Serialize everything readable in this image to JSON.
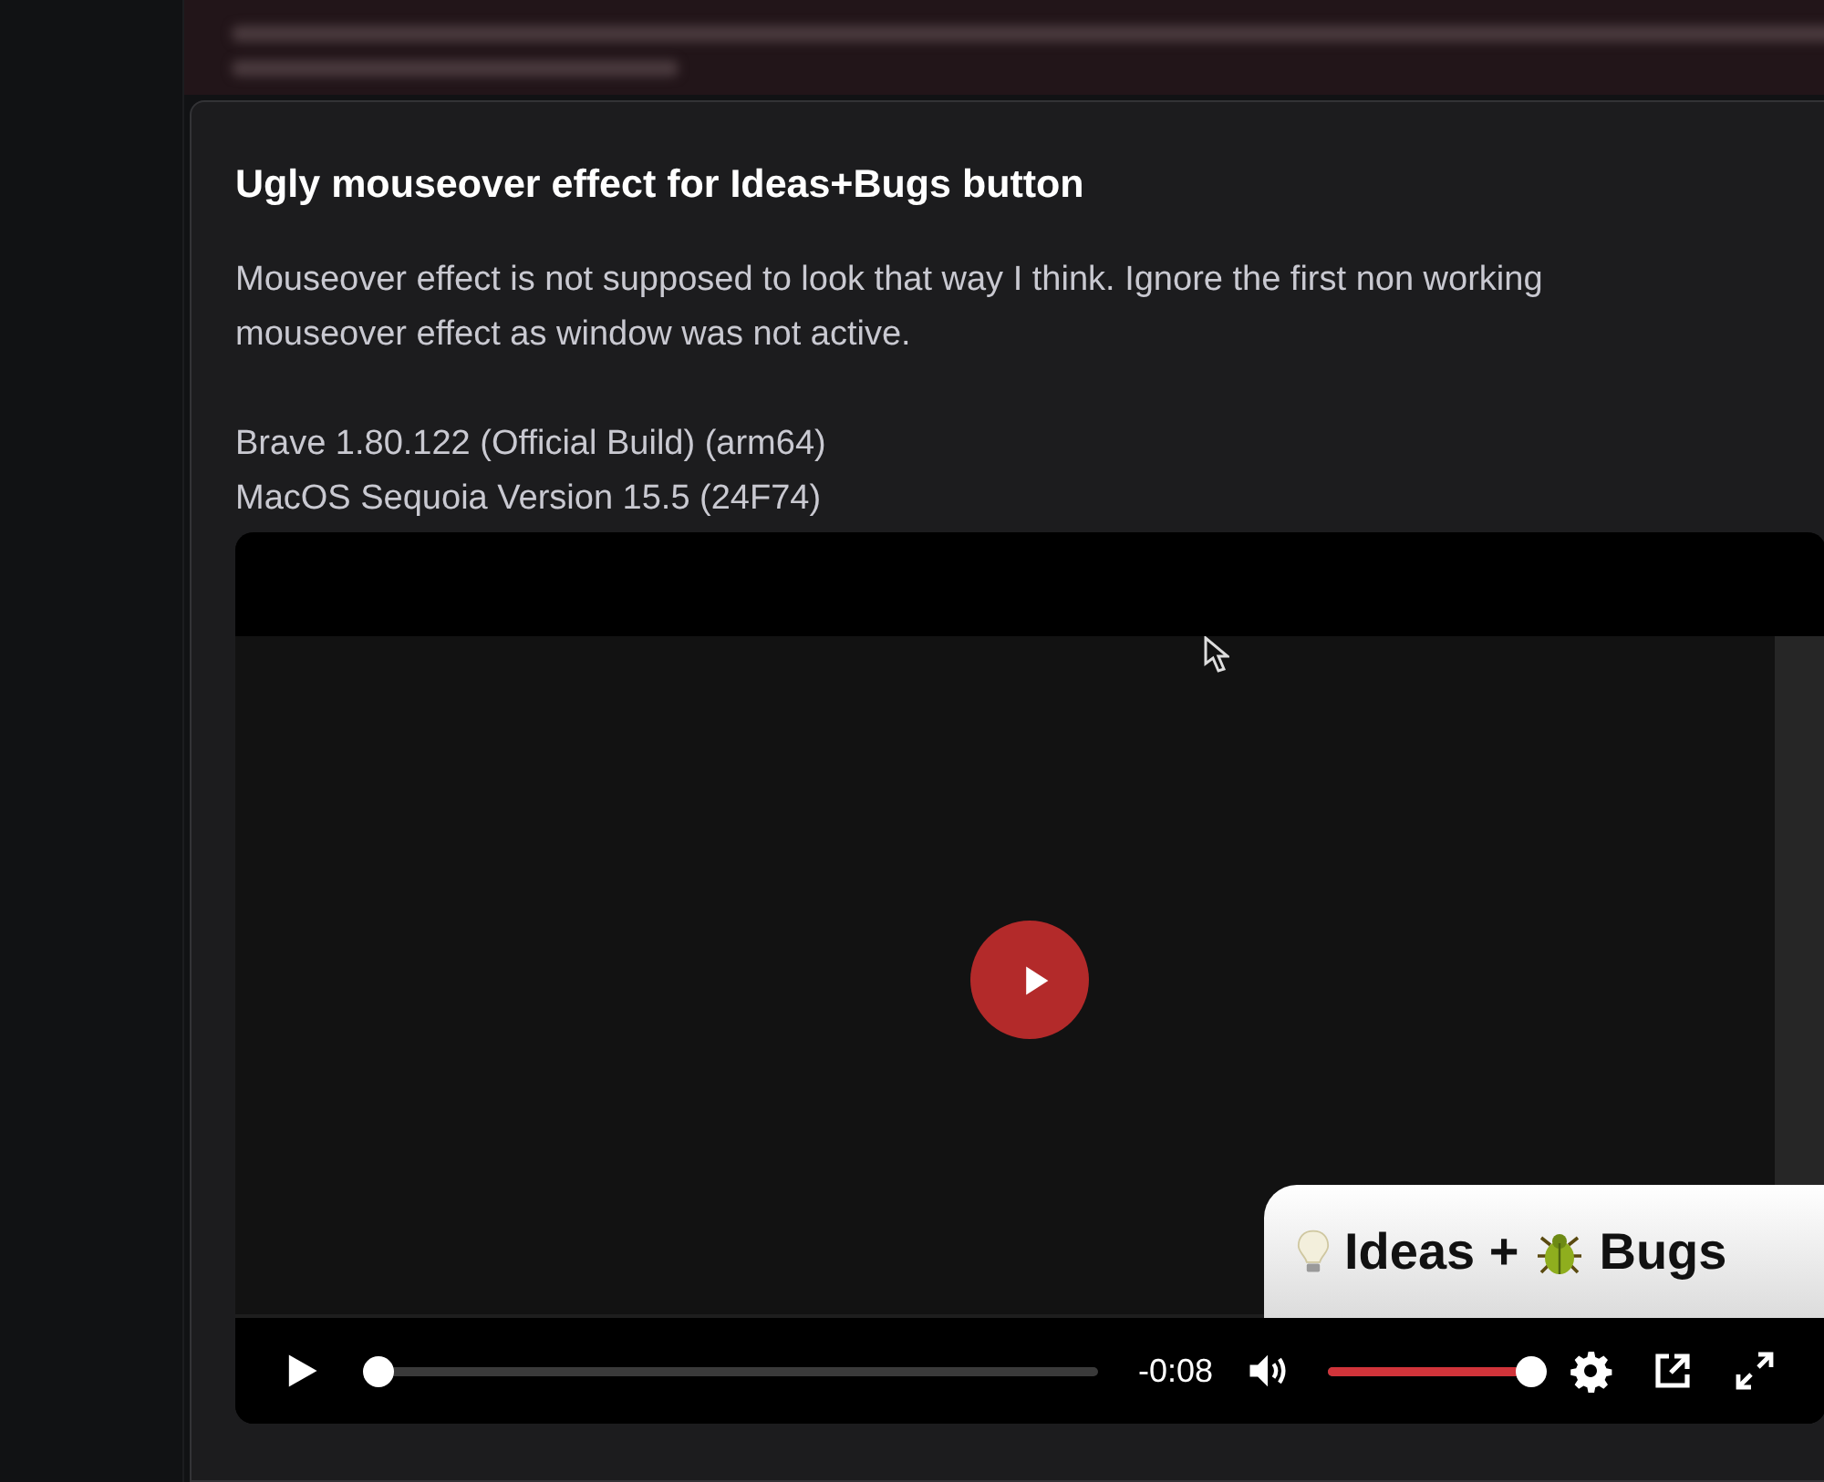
{
  "post": {
    "title": "Ugly mouseover effect for Ideas+Bugs button",
    "paragraphs": [
      "Mouseover effect is not supposed to look that way I think. Ignore the first non working mouseover effect as window was not active.",
      "Brave 1.80.122 (Official Build) (arm64)\nMacOS Sequoia Version 15.5 (24F74)"
    ]
  },
  "video": {
    "recording": {
      "button_labels": [
        "Ideas +",
        "Bugs"
      ]
    },
    "controls": {
      "progress": {
        "level": 0
      },
      "time": "-0:08",
      "volume": {
        "level": 1
      }
    }
  }
}
